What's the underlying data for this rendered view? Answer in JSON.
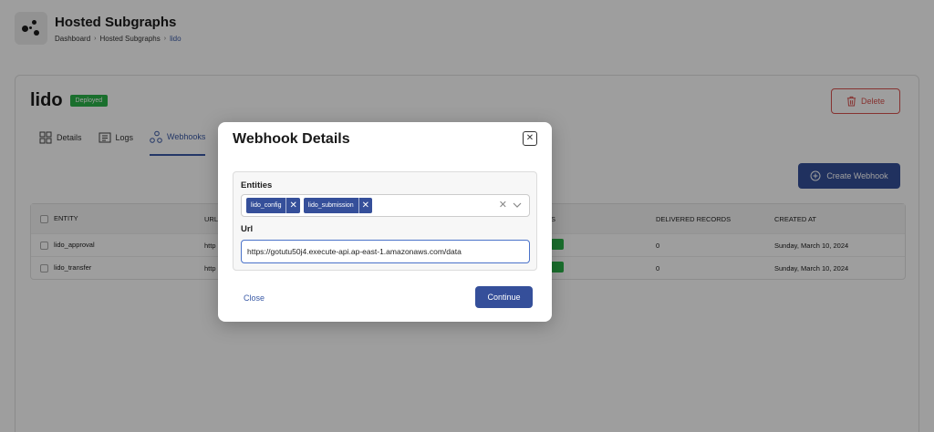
{
  "app": {
    "title": "Hosted Subgraphs",
    "breadcrumb": [
      "Dashboard",
      "Hosted Subgraphs",
      "lido"
    ]
  },
  "subgraph": {
    "name": "lido",
    "status": "Deployed",
    "delete_label": "Delete"
  },
  "tabs": [
    {
      "label": "Details",
      "icon": "grid-icon",
      "active": false
    },
    {
      "label": "Logs",
      "icon": "log-icon",
      "active": false
    },
    {
      "label": "Webhooks",
      "icon": "webhook-icon",
      "active": true
    }
  ],
  "create_webhook_label": "Create Webhook",
  "table": {
    "headers": [
      "ENTITY",
      "URL",
      "",
      "S",
      "DELIVERED RECORDS",
      "CREATED AT"
    ],
    "rows": [
      {
        "entity": "lido_approval",
        "url": "http",
        "delivered": "0",
        "created": "Sunday, March 10, 2024"
      },
      {
        "entity": "lido_transfer",
        "url": "http",
        "delivered": "0",
        "created": "Sunday, March 10, 2024"
      }
    ]
  },
  "modal": {
    "title": "Webhook Details",
    "entities_label": "Entities",
    "entities": [
      "lido_config",
      "lido_submission"
    ],
    "url_label": "Url",
    "url_value": "https://gotutu50j4.execute-api.ap-east-1.amazonaws.com/data",
    "close_label": "Close",
    "continue_label": "Continue"
  },
  "colors": {
    "primary": "#354f9a",
    "success": "#2bb34a",
    "danger": "#d9534f"
  }
}
